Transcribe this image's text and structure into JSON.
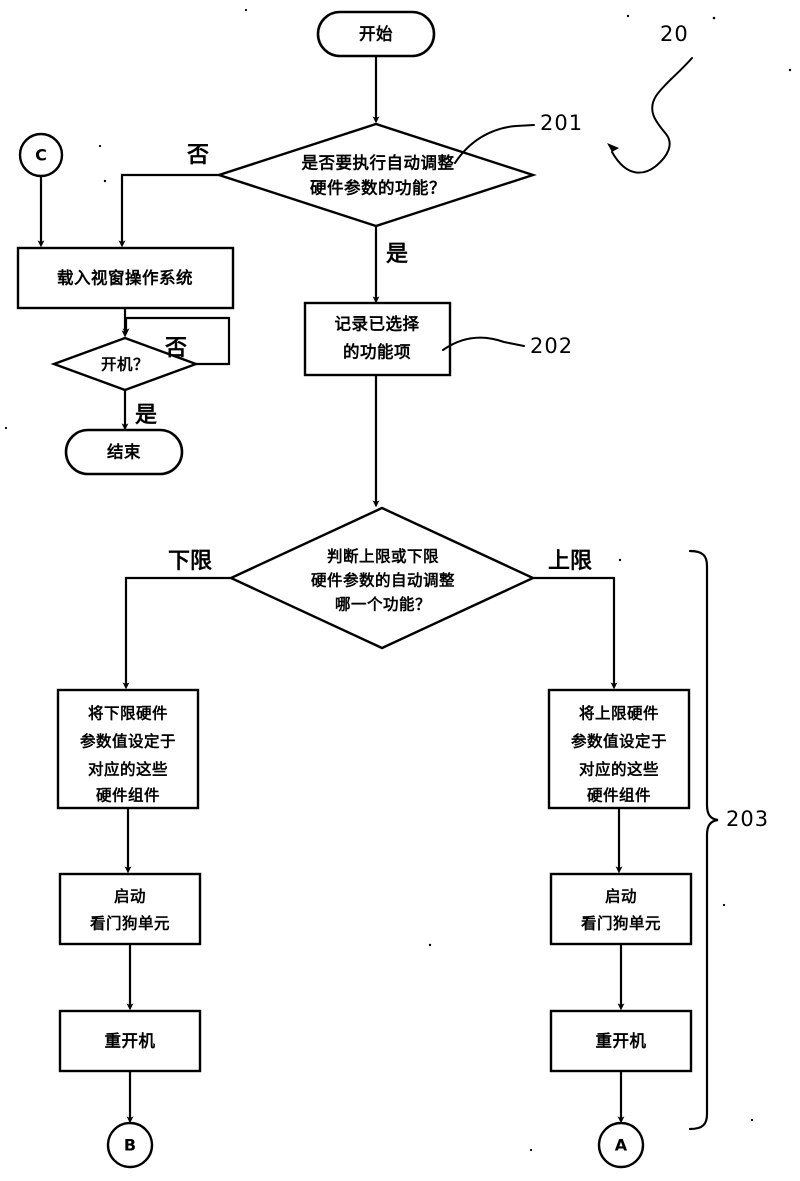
{
  "figure": {
    "figure_number": "20",
    "reference_numerals": {
      "step_201": "201",
      "step_202": "202",
      "step_203": "203"
    }
  },
  "nodes": {
    "start": {
      "label": "开始",
      "shape": "terminator"
    },
    "decision_auto_adjust": {
      "line1": "是否要执行自动调整",
      "line2": "硬件参数的功能？",
      "shape": "decision",
      "branch_no": "否",
      "branch_yes": "是"
    },
    "connector_c": {
      "label": "C",
      "shape": "connector"
    },
    "load_os": {
      "label": "载入视窗操作系统",
      "shape": "process"
    },
    "decision_boot": {
      "label": "开机？",
      "shape": "decision",
      "branch_no": "否",
      "branch_yes": "是"
    },
    "end": {
      "label": "结束",
      "shape": "terminator"
    },
    "record_selection": {
      "line1": "记录已选择",
      "line2": "的功能项",
      "shape": "process"
    },
    "decision_limit": {
      "line1": "判断上限或下限",
      "line2": "硬件参数的自动调整",
      "line3": "哪一个功能？",
      "shape": "decision",
      "branch_lower": "下限",
      "branch_upper": "上限"
    },
    "set_lower_params": {
      "line1": "将下限硬件",
      "line2": "参数值设定于",
      "line3": "对应的这些",
      "line4": "硬件组件",
      "shape": "process"
    },
    "set_upper_params": {
      "line1": "将上限硬件",
      "line2": "参数值设定于",
      "line3": "对应的这些",
      "line4": "硬件组件",
      "shape": "process"
    },
    "start_watchdog_left": {
      "line1": "启动",
      "line2": "看门狗单元",
      "shape": "process"
    },
    "start_watchdog_right": {
      "line1": "启动",
      "line2": "看门狗单元",
      "shape": "process"
    },
    "reboot_left": {
      "label": "重开机",
      "shape": "process"
    },
    "reboot_right": {
      "label": "重开机",
      "shape": "process"
    },
    "connector_b": {
      "label": "B",
      "shape": "connector"
    },
    "connector_a": {
      "label": "A",
      "shape": "connector"
    }
  },
  "colors": {
    "line": "#000000",
    "fill": "#ffffff",
    "background": "#ffffff"
  }
}
